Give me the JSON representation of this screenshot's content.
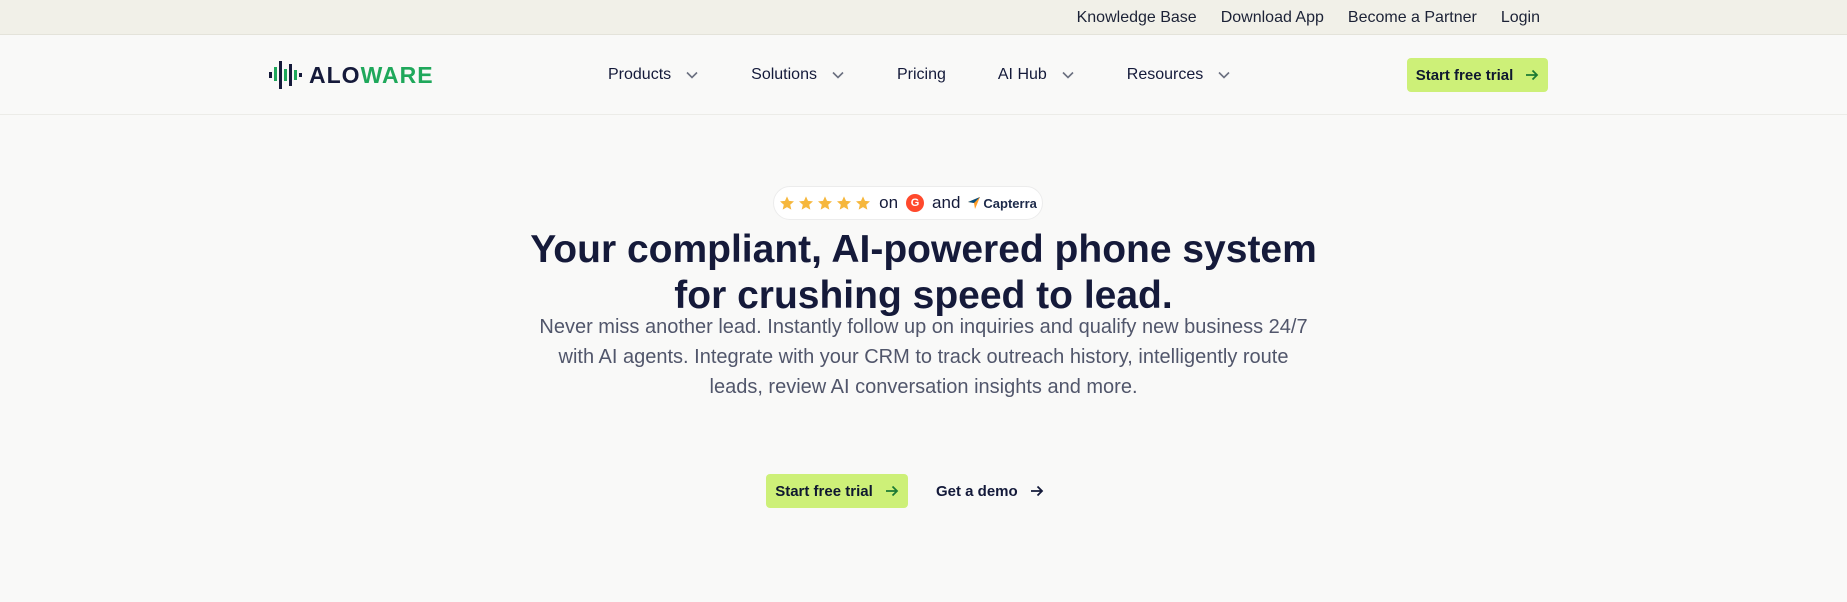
{
  "topbar": {
    "links": [
      "Knowledge Base",
      "Download App",
      "Become a Partner",
      "Login"
    ]
  },
  "brand": {
    "part1": "ALO",
    "part2": "WARE",
    "accent": "#1fa85b",
    "dark": "#151a3a"
  },
  "nav": {
    "items": [
      {
        "label": "Products",
        "dropdown": true
      },
      {
        "label": "Solutions",
        "dropdown": true
      },
      {
        "label": "Pricing",
        "dropdown": false
      },
      {
        "label": "AI Hub",
        "dropdown": true
      },
      {
        "label": "Resources",
        "dropdown": true
      }
    ],
    "cta": "Start free trial"
  },
  "rating": {
    "stars": 5,
    "on": "on",
    "and": "and",
    "review_site_2": "Capterra",
    "star_color": "#f6b73c"
  },
  "hero": {
    "headline_line1": "Your compliant, AI-powered phone system",
    "headline_line2": "for crushing speed to lead.",
    "sub_line1": "Never miss another lead. Instantly follow up on inquiries and qualify new business 24/7",
    "sub_line2": "with AI agents. Integrate with your CRM to track outreach history, intelligently route",
    "sub_line3": "leads, review AI conversation insights and more.",
    "primary_cta": "Start free trial",
    "secondary_cta": "Get a demo"
  },
  "colors": {
    "cta_bg": "#cdf078",
    "topbar_bg": "#f1f0e8",
    "page_bg": "#f9f9f8"
  }
}
